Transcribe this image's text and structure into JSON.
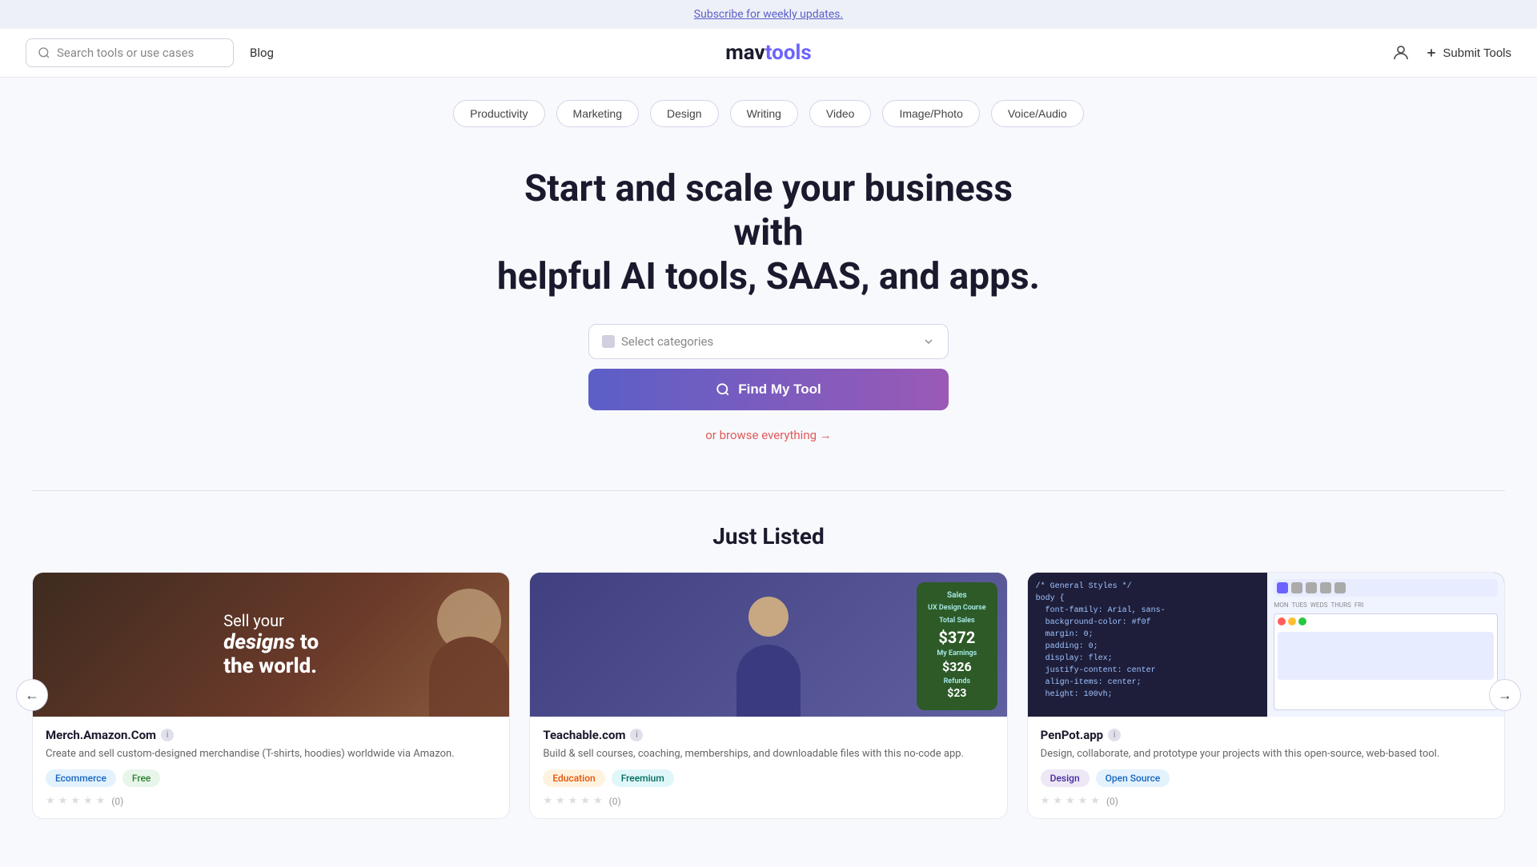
{
  "banner": {
    "text": "Subscribe for weekly updates."
  },
  "header": {
    "search_placeholder": "Search tools or use cases",
    "blog_label": "Blog",
    "logo_mav": "mav",
    "logo_tools": "tools",
    "submit_label": "Submit Tools"
  },
  "categories": [
    "Productivity",
    "Marketing",
    "Design",
    "Writing",
    "Video",
    "Image/Photo",
    "Voice/Audio"
  ],
  "hero": {
    "headline_line1": "Start and scale your business with",
    "headline_line2": "helpful AI tools, SAAS, and apps.",
    "select_placeholder": "Select categories",
    "find_btn_label": "Find My Tool",
    "browse_link": "or browse everything →"
  },
  "just_listed": {
    "section_title": "Just Listed",
    "cards": [
      {
        "id": "merch-amazon",
        "thumb_type": "merch",
        "thumb_text_line1": "Sell your",
        "thumb_text_bold": "designs",
        "thumb_text_line2": "to the world.",
        "title": "Merch.Amazon.Com",
        "description": "Create and sell custom-designed merchandise (T-shirts, hoodies) worldwide via Amazon.",
        "tags": [
          {
            "label": "Ecommerce",
            "style": "blue"
          },
          {
            "label": "Free",
            "style": "green"
          }
        ],
        "rating": 0,
        "rating_count": "(0)"
      },
      {
        "id": "teachable",
        "thumb_type": "teachable",
        "title": "Teachable.com",
        "description": "Build & sell courses, coaching, memberships, and downloadable files with this no-code app.",
        "sales_badge_title": "UX Design Course",
        "sales_total_label": "Total Sales",
        "sales_total": "$372",
        "sales_earnings_label": "My Earnings",
        "sales_earnings": "$326",
        "sales_refunds_label": "Refunds",
        "sales_refunds": "$23",
        "tags": [
          {
            "label": "Education",
            "style": "orange"
          },
          {
            "label": "Freemium",
            "style": "teal"
          }
        ],
        "rating": 0,
        "rating_count": "(0)"
      },
      {
        "id": "penpot",
        "thumb_type": "penpot",
        "penpot_code": "/* General Styles */\nbody {\n  font-family: Arial, sans-\n  background-color: #f0f\n  margin: 0;\n  padding: 0;\n  display: flex;\n  justify-content: center\n  align-items: center;\n  height: 100vh;",
        "title": "PenPot.app",
        "description": "Design, collaborate, and prototype your projects with this open-source, web-based tool.",
        "tags": [
          {
            "label": "Design",
            "style": "purple"
          },
          {
            "label": "Open Source",
            "style": "blue"
          }
        ],
        "rating": 0,
        "rating_count": "(0)"
      }
    ]
  }
}
